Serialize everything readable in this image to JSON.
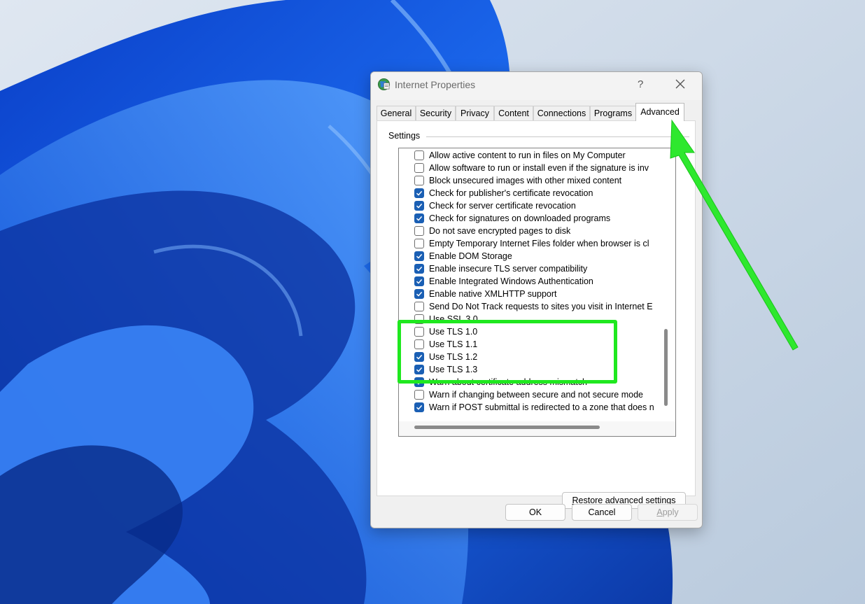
{
  "window": {
    "title": "Internet Properties",
    "help_label": "?"
  },
  "tabs": [
    {
      "label": "General",
      "active": false
    },
    {
      "label": "Security",
      "active": false
    },
    {
      "label": "Privacy",
      "active": false
    },
    {
      "label": "Content",
      "active": false
    },
    {
      "label": "Connections",
      "active": false
    },
    {
      "label": "Programs",
      "active": false
    },
    {
      "label": "Advanced",
      "active": true
    }
  ],
  "settings": {
    "group_label": "Settings",
    "items": [
      {
        "label": "Allow active content to run in files on My Computer",
        "checked": false
      },
      {
        "label": "Allow software to run or install even if the signature is inv",
        "checked": false
      },
      {
        "label": "Block unsecured images with other mixed content",
        "checked": false
      },
      {
        "label": "Check for publisher's certificate revocation",
        "checked": true
      },
      {
        "label": "Check for server certificate revocation",
        "checked": true
      },
      {
        "label": "Check for signatures on downloaded programs",
        "checked": true
      },
      {
        "label": "Do not save encrypted pages to disk",
        "checked": false
      },
      {
        "label": "Empty Temporary Internet Files folder when browser is cl",
        "checked": false
      },
      {
        "label": "Enable DOM Storage",
        "checked": true
      },
      {
        "label": "Enable insecure TLS server compatibility",
        "checked": true
      },
      {
        "label": "Enable Integrated Windows Authentication",
        "checked": true
      },
      {
        "label": "Enable native XMLHTTP support",
        "checked": true
      },
      {
        "label": "Send Do Not Track requests to sites you visit in Internet E",
        "checked": false
      },
      {
        "label": "Use SSL 3.0",
        "checked": false
      },
      {
        "label": "Use TLS 1.0",
        "checked": false
      },
      {
        "label": "Use TLS 1.1",
        "checked": false
      },
      {
        "label": "Use TLS 1.2",
        "checked": true
      },
      {
        "label": "Use TLS 1.3",
        "checked": true
      },
      {
        "label": "Warn about certificate address mismatch",
        "checked": true
      },
      {
        "label": "Warn if changing between secure and not secure mode",
        "checked": false
      },
      {
        "label": "Warn if POST submittal is redirected to a zone that does n",
        "checked": true
      }
    ]
  },
  "buttons": {
    "restore_prefix": "R",
    "restore_rest": "estore advanced settings",
    "ok": "OK",
    "cancel": "Cancel",
    "apply_prefix": "A",
    "apply_rest": "pply"
  },
  "colors": {
    "highlight": "#1fe81f",
    "checkbox_checked": "#1a5fb4"
  },
  "icons": {
    "app": "globe-icon",
    "close": "close-icon",
    "check": "check-icon"
  }
}
